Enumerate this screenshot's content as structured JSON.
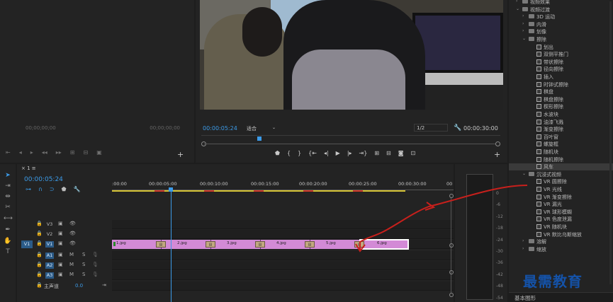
{
  "source_monitor": {
    "timecode_left": "00;00;00;00",
    "timecode_right": "00;00;00;00"
  },
  "program_monitor": {
    "timecode": "00:00:05:24",
    "fit_label": "适合",
    "resolution": "1/2",
    "duration": "00:00:30:00"
  },
  "timeline": {
    "tab_label": "1",
    "timecode": "00:00:05:24",
    "ruler_ticks": [
      ":00:00",
      "00:00:05:00",
      "00:00:10:00",
      "00:00:15:00",
      "00:00:20:00",
      "00:00:25:00",
      "00:00:30:00",
      "00"
    ],
    "tracks": {
      "v3": "V3",
      "v2": "V2",
      "v1": "V1",
      "v1_source": "V1",
      "a1": "A1",
      "a2": "A2",
      "a3": "A3",
      "a1_source": "A1",
      "a2_source": "A2",
      "a3_source": "A3",
      "mute": "M",
      "solo": "S"
    },
    "master": {
      "label": "主声道",
      "value": "0.0"
    },
    "clips": [
      {
        "label": "1.jpg"
      },
      {
        "label": "2.jpg"
      },
      {
        "label": "3.jpg"
      },
      {
        "label": "4.jpg"
      },
      {
        "label": "5.jpg"
      },
      {
        "label": "6.jpg"
      }
    ],
    "transition_label": "风车"
  },
  "meter": {
    "ticks": [
      "0",
      "-6",
      "-12",
      "-18",
      "-24",
      "-30",
      "-36",
      "-42",
      "-48",
      "-54"
    ]
  },
  "effects": {
    "items": [
      {
        "level": 0,
        "type": "folder",
        "label": "视频效果",
        "open": false
      },
      {
        "level": 0,
        "type": "folder",
        "label": "视频过渡",
        "open": true
      },
      {
        "level": 1,
        "type": "folder",
        "label": "3D 运动",
        "open": false
      },
      {
        "level": 1,
        "type": "folder",
        "label": "内滑",
        "open": false
      },
      {
        "level": 1,
        "type": "folder",
        "label": "划像",
        "open": false
      },
      {
        "level": 1,
        "type": "folder",
        "label": "擦除",
        "open": true
      },
      {
        "level": 2,
        "type": "item",
        "label": "划出"
      },
      {
        "level": 2,
        "type": "item",
        "label": "双侧平推门"
      },
      {
        "level": 2,
        "type": "item",
        "label": "带状擦除"
      },
      {
        "level": 2,
        "type": "item",
        "label": "径向擦除"
      },
      {
        "level": 2,
        "type": "item",
        "label": "插入"
      },
      {
        "level": 2,
        "type": "item",
        "label": "时钟式擦除"
      },
      {
        "level": 2,
        "type": "item",
        "label": "棋盘"
      },
      {
        "level": 2,
        "type": "item",
        "label": "棋盘擦除"
      },
      {
        "level": 2,
        "type": "item",
        "label": "楔形擦除"
      },
      {
        "level": 2,
        "type": "item",
        "label": "水波块"
      },
      {
        "level": 2,
        "type": "item",
        "label": "油漆飞溅"
      },
      {
        "level": 2,
        "type": "item",
        "label": "渐变擦除"
      },
      {
        "level": 2,
        "type": "item",
        "label": "百叶窗"
      },
      {
        "level": 2,
        "type": "item",
        "label": "螺旋框"
      },
      {
        "level": 2,
        "type": "item",
        "label": "随机块"
      },
      {
        "level": 2,
        "type": "item",
        "label": "随机擦除"
      },
      {
        "level": 2,
        "type": "item",
        "label": "风车",
        "highlight": true
      },
      {
        "level": 1,
        "type": "folder",
        "label": "沉浸式视频",
        "open": true
      },
      {
        "level": 2,
        "type": "item",
        "label": "VR 圆擦除"
      },
      {
        "level": 2,
        "type": "item",
        "label": "VR 光线"
      },
      {
        "level": 2,
        "type": "item",
        "label": "VR 渐变擦除"
      },
      {
        "level": 2,
        "type": "item",
        "label": "VR 漏光"
      },
      {
        "level": 2,
        "type": "item",
        "label": "VR 球形模糊"
      },
      {
        "level": 2,
        "type": "item",
        "label": "VR 色度泄漏"
      },
      {
        "level": 2,
        "type": "item",
        "label": "VR 随机块"
      },
      {
        "level": 2,
        "type": "item",
        "label": "VR 默比乌斯缩放"
      },
      {
        "level": 1,
        "type": "folder",
        "label": "溶解",
        "open": false
      },
      {
        "level": 1,
        "type": "folder",
        "label": "缩放",
        "open": false
      }
    ],
    "bottom_label": "基本图形"
  },
  "watermark": "最需教育",
  "colors": {
    "accent": "#3c9be8",
    "clip": "#d38ad6",
    "arrow": "#c8201c",
    "watermark": "#1452a8"
  }
}
